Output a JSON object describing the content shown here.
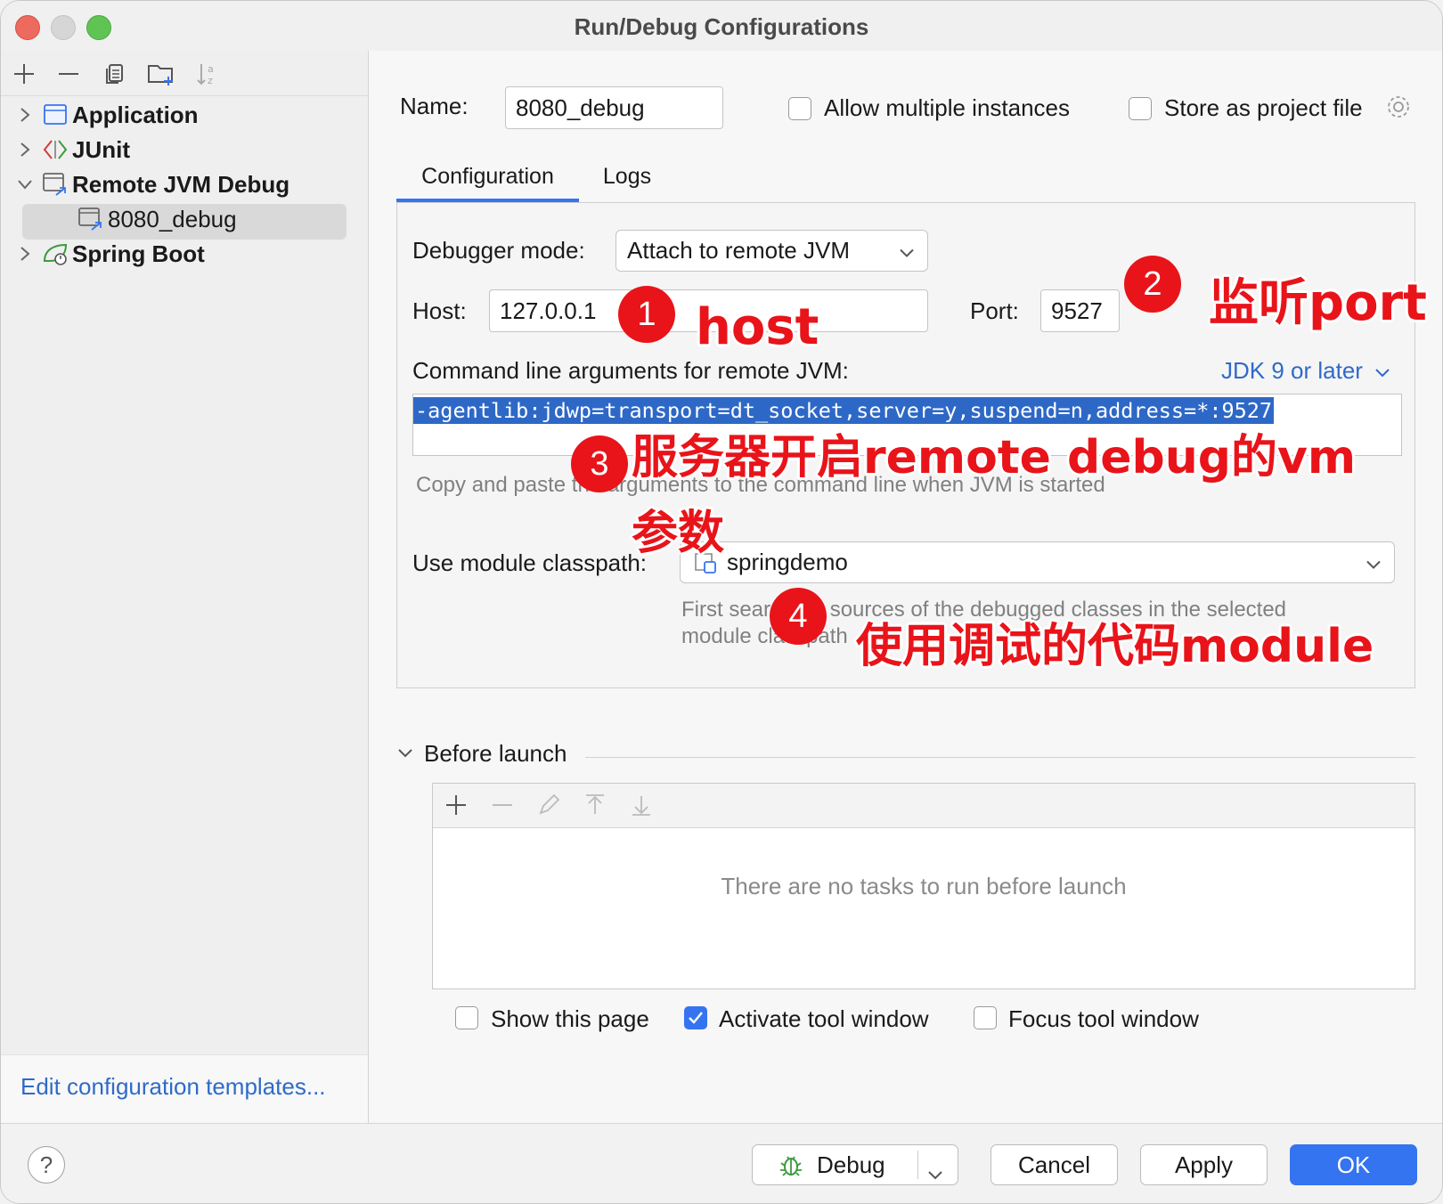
{
  "window": {
    "title": "Run/Debug Configurations"
  },
  "sidebar": {
    "toolbar": [
      "add-icon",
      "remove-icon",
      "copy-icon",
      "new-folder-icon",
      "sort-icon"
    ],
    "items": [
      {
        "label": "Application",
        "icon": "application-icon",
        "expanded": false
      },
      {
        "label": "JUnit",
        "icon": "junit-icon",
        "expanded": false
      },
      {
        "label": "Remote JVM Debug",
        "icon": "remote-debug-icon",
        "expanded": true
      },
      {
        "label": "8080_debug",
        "icon": "remote-debug-icon",
        "selected": true
      },
      {
        "label": "Spring Boot",
        "icon": "spring-boot-icon",
        "expanded": false
      }
    ],
    "footer_link": "Edit configuration templates..."
  },
  "form": {
    "name_label": "Name:",
    "name_value": "8080_debug",
    "allow_multiple_label": "Allow multiple instances",
    "store_project_label": "Store as project file",
    "tabs": [
      "Configuration",
      "Logs"
    ],
    "debugger_mode_label": "Debugger mode:",
    "debugger_mode_value": "Attach to remote JVM",
    "host_label": "Host:",
    "host_value": "127.0.0.1",
    "port_label": "Port:",
    "port_value": "9527",
    "cmd_label": "Command line arguments for remote JVM:",
    "jdk_link": "JDK 9 or later",
    "cmd_value": "-agentlib:jdwp=transport=dt_socket,server=y,suspend=n,address=*:9527",
    "cmd_hint": "Copy and paste the arguments to the command line when JVM is started",
    "classpath_label": "Use module classpath:",
    "classpath_value": "springdemo",
    "classpath_hint_1": "First search for sources of the debugged classes in the selected",
    "classpath_hint_2": "module classpath"
  },
  "before_launch": {
    "title": "Before launch",
    "empty_text": "There are no tasks to run before launch",
    "show_page_label": "Show this page",
    "activate_tool_label": "Activate tool window",
    "focus_tool_label": "Focus tool window"
  },
  "buttons": {
    "help": "?",
    "debug": "Debug",
    "cancel": "Cancel",
    "apply": "Apply",
    "ok": "OK"
  },
  "annotations": [
    {
      "num": "1",
      "text": "host"
    },
    {
      "num": "2",
      "text": "监听port"
    },
    {
      "num": "3",
      "text": "服务器开启remote debug的vm",
      "text2": "参数"
    },
    {
      "num": "4",
      "text": "使用调试的代码module"
    }
  ],
  "colors": {
    "accent": "#3574f0",
    "link": "#2f6ac8",
    "annotation": "#e8141a"
  }
}
